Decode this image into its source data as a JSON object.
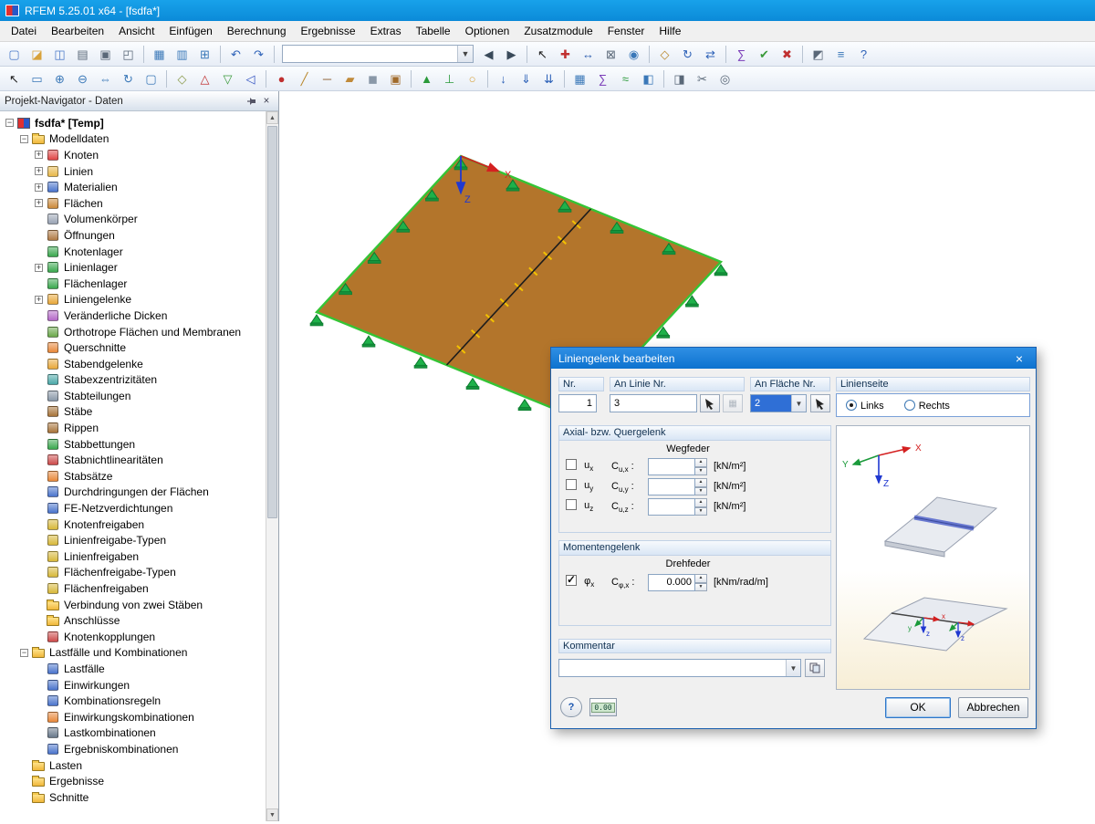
{
  "window": {
    "title": "RFEM 5.25.01 x64 - [fsdfa*]"
  },
  "menubar": {
    "items": [
      "Datei",
      "Bearbeiten",
      "Ansicht",
      "Einfügen",
      "Berechnung",
      "Ergebnisse",
      "Extras",
      "Tabelle",
      "Optionen",
      "Zusatzmodule",
      "Fenster",
      "Hilfe"
    ]
  },
  "toolbar_main": {
    "combo_value": "",
    "icons": [
      {
        "name": "new-file",
        "glyph": "▢",
        "color": "#4a78c8"
      },
      {
        "name": "open-project",
        "glyph": "◪",
        "color": "#d8a23a"
      },
      {
        "name": "save",
        "glyph": "◫",
        "color": "#4a78c8"
      },
      {
        "name": "print",
        "glyph": "▤",
        "color": "#5a6878"
      },
      {
        "name": "copy",
        "glyph": "▣",
        "color": "#5a6878"
      },
      {
        "name": "export",
        "glyph": "◰",
        "color": "#5a6878"
      },
      {
        "sep": true
      },
      {
        "name": "show-tables",
        "glyph": "▦",
        "color": "#3a78b8"
      },
      {
        "name": "table-layout",
        "glyph": "▥",
        "color": "#3a78b8"
      },
      {
        "name": "numbering",
        "glyph": "⊞",
        "color": "#3a78b8"
      },
      {
        "sep": true
      },
      {
        "name": "undo",
        "glyph": "↶",
        "color": "#2e62b8"
      },
      {
        "name": "redo",
        "glyph": "↷",
        "color": "#2e62b8"
      },
      {
        "sep": true
      },
      {
        "combo": true
      },
      {
        "name": "nav-back",
        "glyph": "◀",
        "color": "#3a4a5a"
      },
      {
        "name": "nav-forward",
        "glyph": "▶",
        "color": "#3a4a5a"
      },
      {
        "sep": true
      },
      {
        "name": "pick-object",
        "glyph": "↖",
        "color": "#202020"
      },
      {
        "name": "coordinate-system",
        "glyph": "✚",
        "color": "#c03030"
      },
      {
        "name": "measure",
        "glyph": "↔",
        "color": "#3060b0"
      },
      {
        "name": "lock",
        "glyph": "⊠",
        "color": "#5a6878"
      },
      {
        "name": "visibility",
        "glyph": "◉",
        "color": "#3a78b8"
      },
      {
        "sep": true
      },
      {
        "name": "move",
        "glyph": "◇",
        "color": "#b8862a"
      },
      {
        "name": "rotate",
        "glyph": "↻",
        "color": "#2e62b8"
      },
      {
        "name": "mirror",
        "glyph": "⇄",
        "color": "#2e62b8"
      },
      {
        "sep": true
      },
      {
        "name": "generate",
        "glyph": "∑",
        "color": "#7a3cb8"
      },
      {
        "name": "check-model",
        "glyph": "✔",
        "color": "#3a9a3a"
      },
      {
        "name": "delete",
        "glyph": "✖",
        "color": "#c03030"
      },
      {
        "sep": true
      },
      {
        "name": "rendering-mode",
        "glyph": "◩",
        "color": "#5a6878"
      },
      {
        "name": "display-properties",
        "glyph": "≡",
        "color": "#3a78b8"
      },
      {
        "name": "help",
        "glyph": "?",
        "color": "#2e62b8"
      }
    ]
  },
  "toolbar_second": {
    "icons": [
      {
        "name": "select-pointer",
        "glyph": "↖",
        "color": "#202020"
      },
      {
        "name": "zoom-window",
        "glyph": "▭",
        "color": "#3a78b8"
      },
      {
        "name": "zoom-in",
        "glyph": "⊕",
        "color": "#3a78b8"
      },
      {
        "name": "zoom-out",
        "glyph": "⊖",
        "color": "#3a78b8"
      },
      {
        "name": "pan",
        "glyph": "⇔",
        "color": "#3a78b8"
      },
      {
        "name": "rotate-view",
        "glyph": "↻",
        "color": "#3a78b8"
      },
      {
        "name": "full-extent",
        "glyph": "▢",
        "color": "#3a78b8"
      },
      {
        "sep": true
      },
      {
        "name": "isometric-view",
        "glyph": "◇",
        "color": "#8a9a4a"
      },
      {
        "name": "view-x",
        "glyph": "△",
        "color": "#c03030"
      },
      {
        "name": "view-y",
        "glyph": "▽",
        "color": "#3a9a3a"
      },
      {
        "name": "view-z",
        "glyph": "◁",
        "color": "#3050c0"
      },
      {
        "sep": true
      },
      {
        "name": "new-node",
        "glyph": "●",
        "color": "#c03030"
      },
      {
        "name": "new-line",
        "glyph": "╱",
        "color": "#b8862a"
      },
      {
        "name": "new-member",
        "glyph": "─",
        "color": "#8a5a2a"
      },
      {
        "name": "new-surface",
        "glyph": "▰",
        "color": "#c08a3a"
      },
      {
        "name": "new-solid",
        "glyph": "◼",
        "color": "#8a98a8"
      },
      {
        "name": "new-opening",
        "glyph": "▣",
        "color": "#a06a2a"
      },
      {
        "sep": true
      },
      {
        "name": "nodal-support",
        "glyph": "▲",
        "color": "#2a9a3a"
      },
      {
        "name": "line-support",
        "glyph": "⊥",
        "color": "#2a9a3a"
      },
      {
        "name": "line-hinge",
        "glyph": "○",
        "color": "#d8a23a"
      },
      {
        "sep": true
      },
      {
        "name": "nodal-load",
        "glyph": "↓",
        "color": "#2e62b8"
      },
      {
        "name": "member-load",
        "glyph": "⇓",
        "color": "#2e62b8"
      },
      {
        "name": "surface-load",
        "glyph": "⇊",
        "color": "#2e62b8"
      },
      {
        "sep": true
      },
      {
        "name": "fe-mesh",
        "glyph": "▦",
        "color": "#3a78b8"
      },
      {
        "name": "calculate",
        "glyph": "∑",
        "color": "#7a3cb8"
      },
      {
        "name": "results-display",
        "glyph": "≈",
        "color": "#2a9a3a"
      },
      {
        "name": "control-panel",
        "glyph": "◧",
        "color": "#3a78b8"
      },
      {
        "sep": true
      },
      {
        "name": "solid-render",
        "glyph": "◨",
        "color": "#5a6878"
      },
      {
        "name": "section",
        "glyph": "✂",
        "color": "#5a6878"
      },
      {
        "name": "snapshot",
        "glyph": "◎",
        "color": "#5a6878"
      }
    ]
  },
  "navigator": {
    "title": "Projekt-Navigator - Daten",
    "tree": [
      {
        "label": "fsdfa* [Temp]",
        "level": 0,
        "exp": "-",
        "icon": "project",
        "color": ""
      },
      {
        "label": "Modelldaten",
        "level": 1,
        "exp": "-",
        "icon": "folder",
        "color": ""
      },
      {
        "label": "Knoten",
        "level": 2,
        "exp": "+",
        "icon": "item",
        "color": "#e04545"
      },
      {
        "label": "Linien",
        "level": 2,
        "exp": "+",
        "icon": "item",
        "color": "#e8b84a"
      },
      {
        "label": "Materialien",
        "level": 2,
        "exp": "+",
        "icon": "item",
        "color": "#4a74cc"
      },
      {
        "label": "Flächen",
        "level": 2,
        "exp": "+",
        "icon": "item",
        "color": "#cc8a3a"
      },
      {
        "label": "Volumenkörper",
        "level": 2,
        "exp": "",
        "icon": "item",
        "color": "#9aa4b4"
      },
      {
        "label": "Öffnungen",
        "level": 2,
        "exp": "",
        "icon": "item",
        "color": "#b07a45"
      },
      {
        "label": "Knotenlager",
        "level": 2,
        "exp": "",
        "icon": "item",
        "color": "#3aa84e"
      },
      {
        "label": "Linienlager",
        "level": 2,
        "exp": "+",
        "icon": "item",
        "color": "#3aa84e"
      },
      {
        "label": "Flächenlager",
        "level": 2,
        "exp": "",
        "icon": "item",
        "color": "#3aa84e"
      },
      {
        "label": "Liniengelenke",
        "level": 2,
        "exp": "+",
        "icon": "item",
        "color": "#e8a83a"
      },
      {
        "label": "Veränderliche Dicken",
        "level": 2,
        "exp": "",
        "icon": "item",
        "color": "#b468c8"
      },
      {
        "label": "Orthotrope Flächen und Membranen",
        "level": 2,
        "exp": "",
        "icon": "item",
        "color": "#6aa84a"
      },
      {
        "label": "Querschnitte",
        "level": 2,
        "exp": "",
        "icon": "item",
        "color": "#e8883a"
      },
      {
        "label": "Stabendgelenke",
        "level": 2,
        "exp": "",
        "icon": "item",
        "color": "#e8a83a"
      },
      {
        "label": "Stabexzentrizitäten",
        "level": 2,
        "exp": "",
        "icon": "item",
        "color": "#4aa8a8"
      },
      {
        "label": "Stabteilungen",
        "level": 2,
        "exp": "",
        "icon": "item",
        "color": "#8a98a8"
      },
      {
        "label": "Stäbe",
        "level": 2,
        "exp": "",
        "icon": "item",
        "color": "#a8743a"
      },
      {
        "label": "Rippen",
        "level": 2,
        "exp": "",
        "icon": "item",
        "color": "#a8743a"
      },
      {
        "label": "Stabbettungen",
        "level": 2,
        "exp": "",
        "icon": "item",
        "color": "#3aa84e"
      },
      {
        "label": "Stabnichtlinearitäten",
        "level": 2,
        "exp": "",
        "icon": "item",
        "color": "#cc4a4a"
      },
      {
        "label": "Stabsätze",
        "level": 2,
        "exp": "",
        "icon": "item",
        "color": "#e8883a"
      },
      {
        "label": "Durchdringungen der Flächen",
        "level": 2,
        "exp": "",
        "icon": "item",
        "color": "#4a74cc"
      },
      {
        "label": "FE-Netzverdichtungen",
        "level": 2,
        "exp": "",
        "icon": "item",
        "color": "#4a74cc"
      },
      {
        "label": "Knotenfreigaben",
        "level": 2,
        "exp": "",
        "icon": "item",
        "color": "#d8b83a"
      },
      {
        "label": "Linienfreigabe-Typen",
        "level": 2,
        "exp": "",
        "icon": "item",
        "color": "#d8b83a"
      },
      {
        "label": "Linienfreigaben",
        "level": 2,
        "exp": "",
        "icon": "item",
        "color": "#d8b83a"
      },
      {
        "label": "Flächenfreigabe-Typen",
        "level": 2,
        "exp": "",
        "icon": "item",
        "color": "#d8b83a"
      },
      {
        "label": "Flächenfreigaben",
        "level": 2,
        "exp": "",
        "icon": "item",
        "color": "#d8b83a"
      },
      {
        "label": "Verbindung von zwei Stäben",
        "level": 2,
        "exp": "",
        "icon": "folder",
        "color": ""
      },
      {
        "label": "Anschlüsse",
        "level": 2,
        "exp": "",
        "icon": "folder",
        "color": ""
      },
      {
        "label": "Knotenkopplungen",
        "level": 2,
        "exp": "",
        "icon": "item",
        "color": "#cc4a4a"
      },
      {
        "label": "Lastfälle und Kombinationen",
        "level": 1,
        "exp": "-",
        "icon": "folder",
        "color": ""
      },
      {
        "label": "Lastfälle",
        "level": 2,
        "exp": "",
        "icon": "item",
        "color": "#4a74cc"
      },
      {
        "label": "Einwirkungen",
        "level": 2,
        "exp": "",
        "icon": "item",
        "color": "#4a74cc"
      },
      {
        "label": "Kombinationsregeln",
        "level": 2,
        "exp": "",
        "icon": "item",
        "color": "#4a74cc"
      },
      {
        "label": "Einwirkungskombinationen",
        "level": 2,
        "exp": "",
        "icon": "item",
        "color": "#e8883a"
      },
      {
        "label": "Lastkombinationen",
        "level": 2,
        "exp": "",
        "icon": "item",
        "color": "#68788a"
      },
      {
        "label": "Ergebniskombinationen",
        "level": 2,
        "exp": "",
        "icon": "item",
        "color": "#4a74cc"
      },
      {
        "label": "Lasten",
        "level": 1,
        "exp": "",
        "icon": "folder",
        "color": ""
      },
      {
        "label": "Ergebnisse",
        "level": 1,
        "exp": "",
        "icon": "folder",
        "color": ""
      },
      {
        "label": "Schnitte",
        "level": 1,
        "exp": "",
        "icon": "folder",
        "color": ""
      }
    ]
  },
  "viewport": {
    "axis_x": "X",
    "axis_z": "Z"
  },
  "dialog": {
    "title": "Liniengelenk bearbeiten",
    "nr": {
      "label": "Nr.",
      "value": "1"
    },
    "line": {
      "label": "An Linie Nr.",
      "value": "3"
    },
    "surface": {
      "label": "An Fläche Nr.",
      "value": "2"
    },
    "side": {
      "label": "Linienseite",
      "options": [
        "Links",
        "Rechts"
      ],
      "selected": 0
    },
    "axial": {
      "title": "Axial- bzw. Quergelenk",
      "spring_header": "Wegfeder",
      "rows": [
        {
          "dof": "u",
          "sub": "x",
          "coef": "C",
          "coef_sub": "u,x",
          "value": "",
          "unit": "[kN/m²]",
          "checked": false
        },
        {
          "dof": "u",
          "sub": "y",
          "coef": "C",
          "coef_sub": "u,y",
          "value": "",
          "unit": "[kN/m²]",
          "checked": false
        },
        {
          "dof": "u",
          "sub": "z",
          "coef": "C",
          "coef_sub": "u,z",
          "value": "",
          "unit": "[kN/m²]",
          "checked": false
        }
      ]
    },
    "moment": {
      "title": "Momentengelenk",
      "spring_header": "Drehfeder",
      "row": {
        "dof": "φ",
        "sub": "x",
        "coef": "C",
        "coef_sub": "φ,x",
        "value": "0.000",
        "unit": "[kNm/rad/m]",
        "checked": true
      }
    },
    "comment": {
      "label": "Kommentar",
      "value": ""
    },
    "calc_label": "0.00",
    "help_label": "?",
    "buttons": {
      "ok": "OK",
      "cancel": "Abbrechen"
    },
    "picture": {
      "axis_x": "X",
      "axis_y": "Y",
      "axis_z": "Z",
      "mini_x": "x",
      "mini_y": "y",
      "mini_z": "z"
    }
  }
}
